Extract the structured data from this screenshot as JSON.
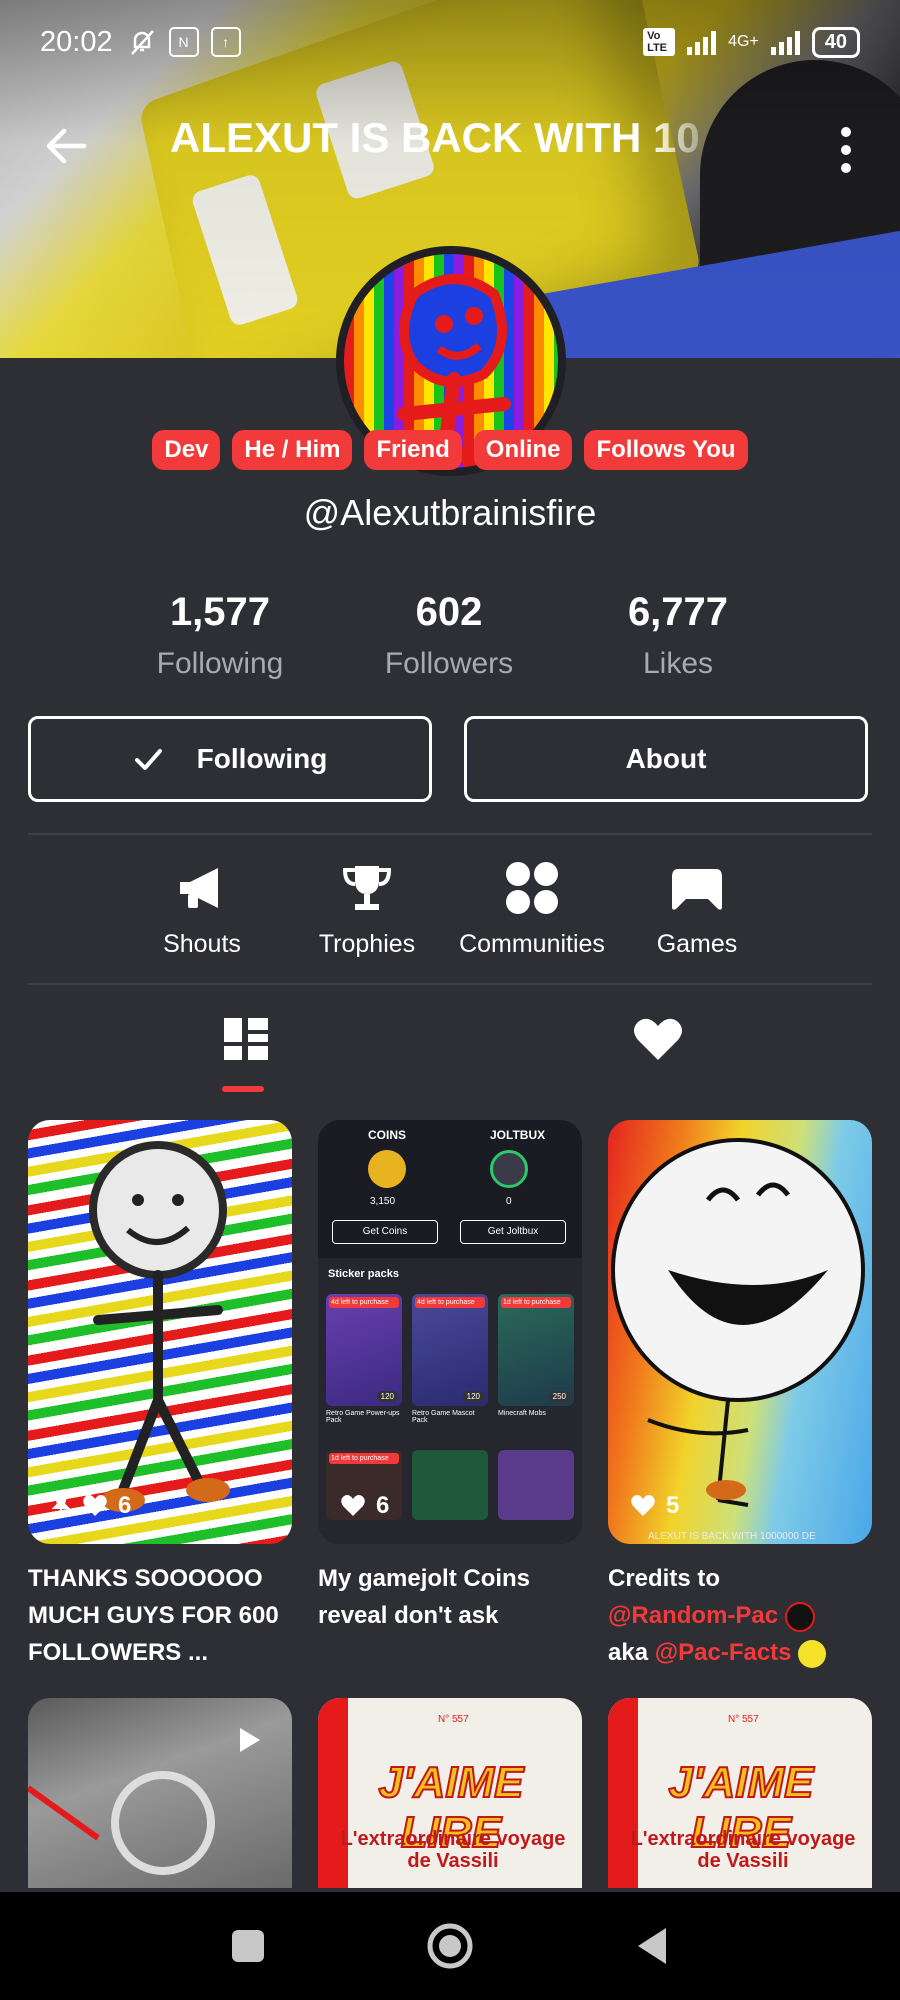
{
  "status_bar": {
    "time": "20:02",
    "network": "4G+",
    "volte": "Vo LTE",
    "battery": "40"
  },
  "header": {
    "title": "ALEXUT IS BACK WITH 10"
  },
  "badges": [
    "Dev",
    "He / Him",
    "Friend",
    "Online",
    "Follows You"
  ],
  "profile": {
    "handle": "@Alexutbrainisfire"
  },
  "stats": [
    {
      "value": "1,577",
      "label": "Following"
    },
    {
      "value": "602",
      "label": "Followers"
    },
    {
      "value": "6,777",
      "label": "Likes"
    }
  ],
  "actions": {
    "following_label": "Following",
    "about_label": "About"
  },
  "quick_links": [
    {
      "label": "Shouts",
      "icon": "megaphone-icon"
    },
    {
      "label": "Trophies",
      "icon": "trophy-icon"
    },
    {
      "label": "Communities",
      "icon": "communities-icon"
    },
    {
      "label": "Games",
      "icon": "gamepad-icon"
    }
  ],
  "tabs": [
    {
      "icon": "dashboard-icon",
      "active": true
    },
    {
      "icon": "heart-icon",
      "active": false
    }
  ],
  "posts": [
    {
      "likes": "6",
      "pinned": true,
      "caption": "THANKS SOOOOOO MUCH GUYS FOR 600 FOLLOWERS ..."
    },
    {
      "likes": "6",
      "pinned": false,
      "caption": "My gamejolt Coins reveal don't ask",
      "shop": {
        "coins_label": "COINS",
        "joltbux_label": "JOLTBUX",
        "coins_value": "3,150",
        "joltbux_value": "0",
        "get_coins": "Get Coins",
        "get_joltbux": "Get Joltbux",
        "sticker_packs": "Sticker packs",
        "packs": [
          {
            "timer": "4d left to purchase",
            "price": "120",
            "name": "Retro Game Power-ups Pack"
          },
          {
            "timer": "4d left to purchase",
            "price": "120",
            "name": "Retro Game Mascot Pack"
          },
          {
            "timer": "1d left to purchase",
            "price": "250",
            "name": "Minecraft Mobs"
          }
        ],
        "extra_timer": "1d left to purchase"
      }
    },
    {
      "likes": "5",
      "pinned": false,
      "caption_prefix": "Credits to ",
      "mention1": "@Random-Pac",
      "caption_mid": "aka ",
      "mention2": "@Pac-Facts",
      "overlay_text": "ALEXUT IS BACK WITH 1000000 DE"
    }
  ],
  "second_row": [
    {
      "type": "video"
    },
    {
      "magazine_title": "J'AIME LIRE",
      "magazine_sub": "L'extraordinaire voyage de Vassili",
      "issue": "N° 557"
    },
    {
      "magazine_title": "J'AIME LIRE",
      "magazine_sub": "L'extraordinaire voyage de Vassili",
      "issue": "N° 557"
    }
  ],
  "colors": {
    "accent": "#f23a3a",
    "background": "#2e2e35",
    "muted": "#a9a9b0"
  }
}
